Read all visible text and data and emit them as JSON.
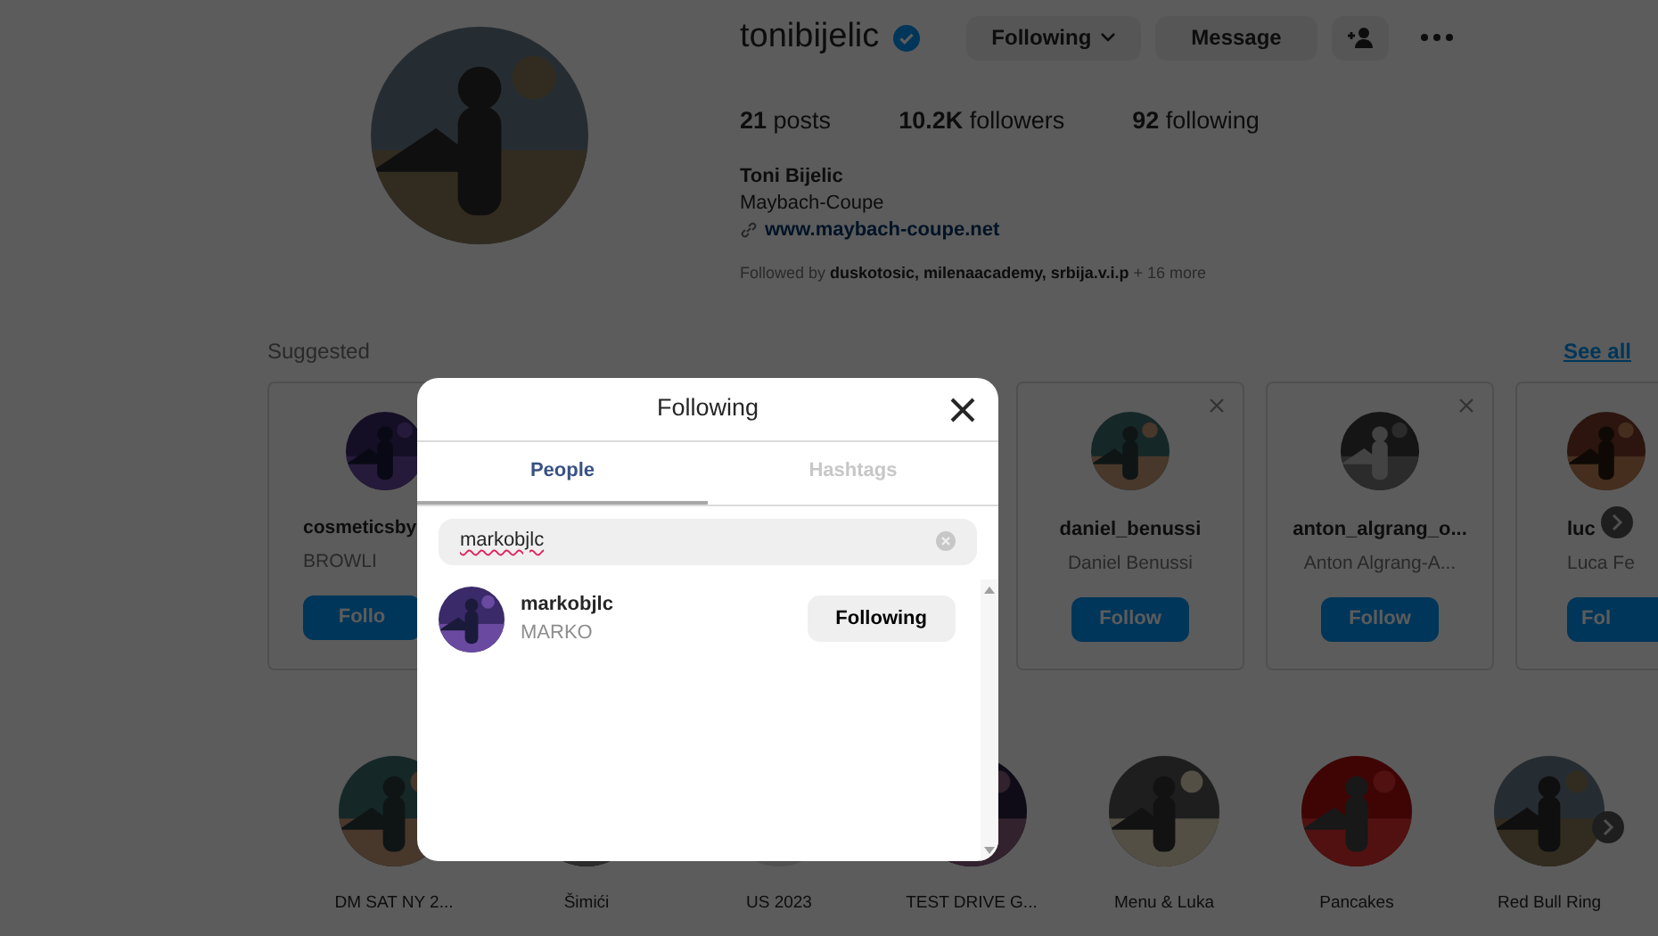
{
  "profile": {
    "username": "tonibijelic",
    "verified": true,
    "buttons": [
      {
        "label": "Following",
        "kind": "dropdown"
      },
      {
        "label": "Message",
        "kind": "plain"
      },
      {
        "kind": "add-person"
      }
    ],
    "stats": [
      {
        "count": "21",
        "label": "posts"
      },
      {
        "count": "10.2K",
        "label": "followers"
      },
      {
        "count": "92",
        "label": "following"
      }
    ],
    "full_name": "Toni Bijelic",
    "bio": "Maybach-Coupe",
    "link": "www.maybach-coupe.net",
    "followed_by": {
      "prefix": "Followed by",
      "names": "duskotosic, milenaacademy, srbija.v.i.p",
      "suffix": "+ 16 more"
    }
  },
  "suggested": {
    "title": "Suggested",
    "see_all": "See all",
    "cards": [
      {
        "username": "cosmeticsby",
        "name": "BROWLI",
        "button": "Follo",
        "dismissable": false
      },
      {
        "username": "daniel_benussi",
        "name": "Daniel Benussi",
        "button": "Follow",
        "dismissable": true
      },
      {
        "username": "anton_algrang_o...",
        "name": "Anton Algrang-A...",
        "button": "Follow",
        "dismissable": true
      },
      {
        "username": "luc",
        "name": "Luca Fe",
        "button": "Fol",
        "dismissable": false
      }
    ]
  },
  "highlights": [
    {
      "label": "DM SAT NY 2...",
      "kind": "picture"
    },
    {
      "label": "Šimići",
      "kind": "picture"
    },
    {
      "label": "US 2023",
      "kind": "hidden"
    },
    {
      "label": "TEST DRIVE G...",
      "kind": "picture"
    },
    {
      "label": "Menu & Luka",
      "kind": "picture"
    },
    {
      "label": "Pancakes",
      "kind": "picture"
    },
    {
      "label": "Red Bull Ring",
      "kind": "picture"
    }
  ],
  "modal": {
    "title": "Following",
    "tabs": [
      {
        "label": "People",
        "selected": true
      },
      {
        "label": "Hashtags",
        "selected": false
      }
    ],
    "search": {
      "value": "markobjlc"
    },
    "results": [
      {
        "username": "markobjlc",
        "name": "MARKO",
        "button": "Following"
      }
    ]
  }
}
